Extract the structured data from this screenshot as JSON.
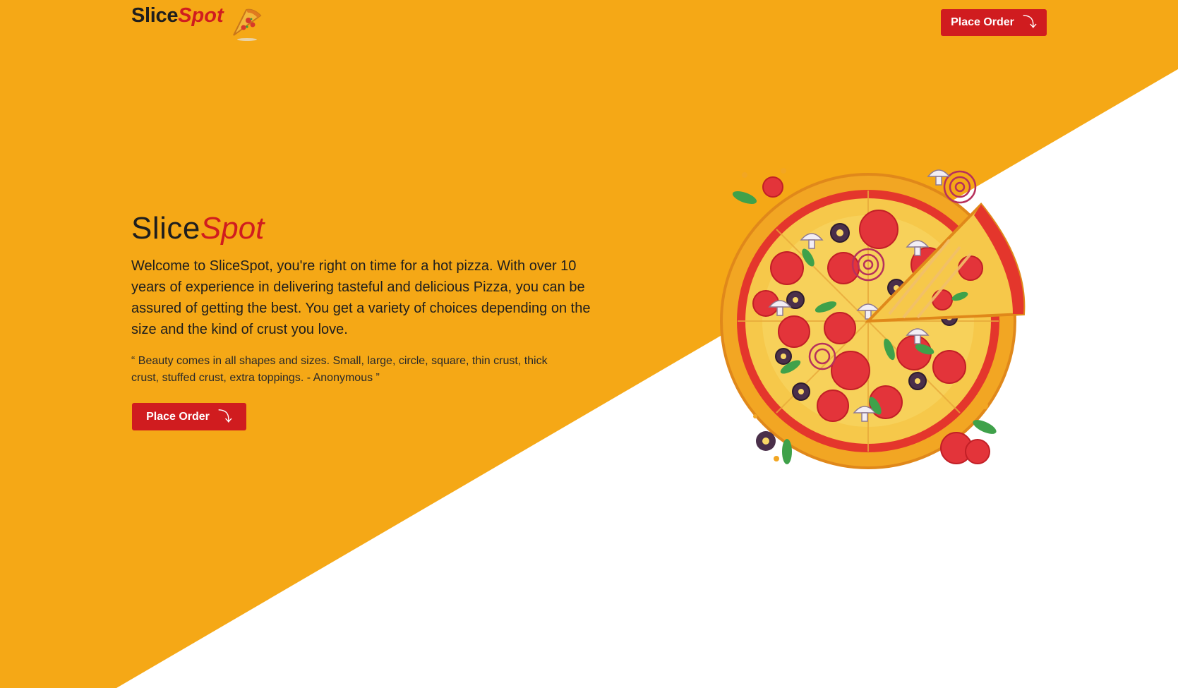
{
  "colors": {
    "background_primary": "#F5A816",
    "background_secondary": "#FFFFFF",
    "accent_red": "#D01C1F",
    "text_dark": "#1E1E1E"
  },
  "header": {
    "logo": {
      "part1": "Slice",
      "part2": "Spot",
      "icon": "pizza-slice-icon"
    },
    "cta": {
      "label": "Place Order",
      "icon": "arrow-down-icon",
      "glyph": "⤵"
    }
  },
  "hero": {
    "title_part1": "Slice",
    "title_part2": "Spot",
    "description": "Welcome to SliceSpot, you're right on time for a hot pizza. With over 10 years of experience in delivering tasteful and delicious Pizza, you can be assured of getting the best. You get a variety of choices depending on the size and the kind of crust you love.",
    "quote": "“ Beauty comes in all shapes and sizes. Small, large, circle, square, thin crust, thick crust, stuffed crust, extra toppings. - Anonymous ”",
    "cta": {
      "label": "Place Order",
      "icon": "arrow-down-icon",
      "glyph": "⤵"
    },
    "image": "pizza-illustration"
  }
}
